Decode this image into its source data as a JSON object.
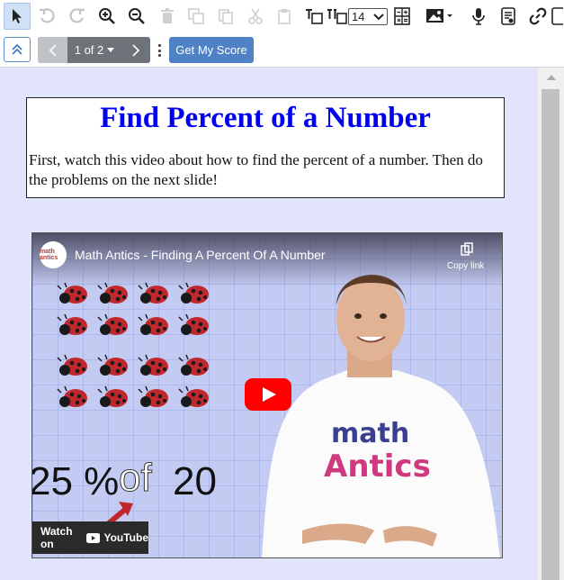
{
  "toolbar": {
    "font_size_value": "14"
  },
  "nav": {
    "page_label": "1 of 2",
    "score_label": "Get My Score"
  },
  "slide": {
    "title": "Find Percent of a Number",
    "body": "First, watch this video about how to find the percent of a number. Then do the problems on the next slide!"
  },
  "video": {
    "title": "Math Antics - Finding A Percent Of A Number",
    "copy_link_label": "Copy link",
    "watch_on_label": "Watch on",
    "youtube_label": "YouTube",
    "channel_logo_text": "math antics",
    "shirt_text_top": "math",
    "shirt_text_bottom": "Antics",
    "equation_left": "25 %",
    "equation_of": "of",
    "equation_right": "20"
  },
  "colors": {
    "title_blue": "#0000ee",
    "score_button": "#4f82c4",
    "stage_bg": "#e1e4fb",
    "play_red": "#ff0000"
  }
}
